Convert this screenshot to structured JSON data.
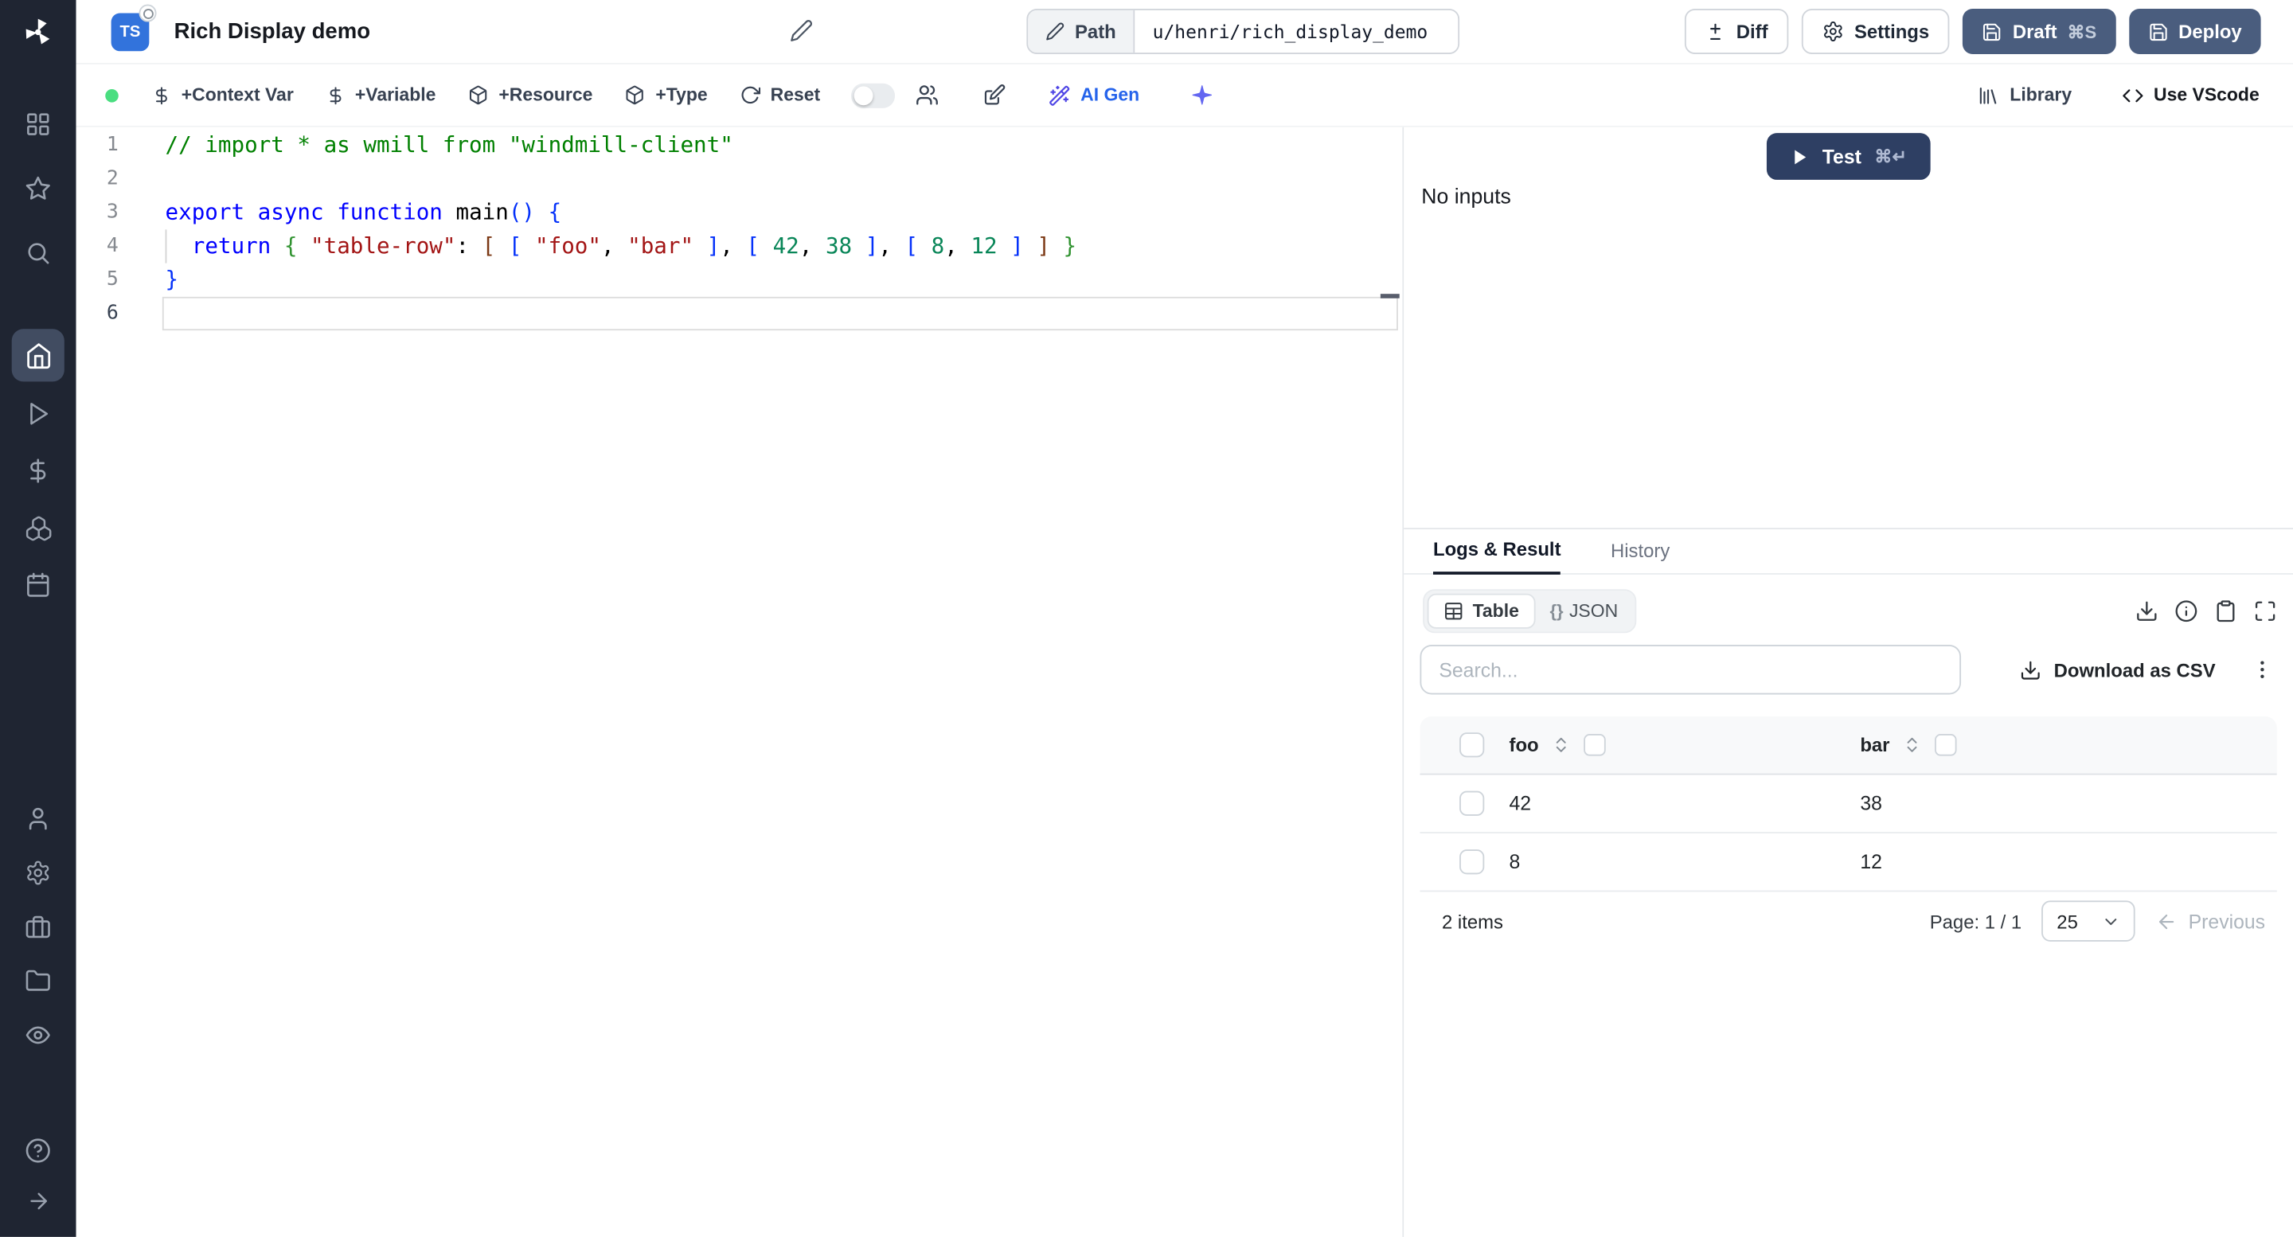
{
  "sidebar": {
    "icon_names": [
      "windmill-logo",
      "apps-grid",
      "favorites-star",
      "search",
      "home",
      "runs-play",
      "variables-dollar",
      "resources-boxes",
      "schedules-calendar",
      "users",
      "settings-gear",
      "workers-briefcase",
      "folders",
      "audit-eye",
      "help",
      "expand-arrow"
    ]
  },
  "header": {
    "lang_badge": "TS",
    "title": "Rich Display demo",
    "path_label": "Path",
    "path_value": "u/henri/rich_display_demo",
    "diff_label": "Diff",
    "settings_label": "Settings",
    "draft_label": "Draft",
    "draft_shortcut": "⌘S",
    "deploy_label": "Deploy"
  },
  "toolbar": {
    "context_var_label": "+Context Var",
    "variable_label": "+Variable",
    "resource_label": "+Resource",
    "type_label": "+Type",
    "reset_label": "Reset",
    "ai_gen_label": "AI Gen",
    "library_label": "Library",
    "vscode_label": "Use VScode"
  },
  "editor": {
    "lines": [
      {
        "n": 1,
        "tokens": [
          {
            "c": "comment",
            "t": "// import * as wmill from \"windmill-client\""
          }
        ]
      },
      {
        "n": 2,
        "tokens": []
      },
      {
        "n": 3,
        "tokens": [
          {
            "c": "kw",
            "t": "export"
          },
          {
            "c": "plain",
            "t": " "
          },
          {
            "c": "kw",
            "t": "async"
          },
          {
            "c": "plain",
            "t": " "
          },
          {
            "c": "kw",
            "t": "function"
          },
          {
            "c": "plain",
            "t": " main"
          },
          {
            "c": "b1",
            "t": "()"
          },
          {
            "c": "plain",
            "t": " "
          },
          {
            "c": "b1",
            "t": "{"
          }
        ]
      },
      {
        "n": 4,
        "tokens": [
          {
            "c": "plain",
            "t": "  "
          },
          {
            "c": "kw",
            "t": "return"
          },
          {
            "c": "plain",
            "t": " "
          },
          {
            "c": "b2",
            "t": "{"
          },
          {
            "c": "plain",
            "t": " "
          },
          {
            "c": "str",
            "t": "\"table-row\""
          },
          {
            "c": "plain",
            "t": ": "
          },
          {
            "c": "b3",
            "t": "["
          },
          {
            "c": "plain",
            "t": " "
          },
          {
            "c": "b1",
            "t": "["
          },
          {
            "c": "plain",
            "t": " "
          },
          {
            "c": "str",
            "t": "\"foo\""
          },
          {
            "c": "plain",
            "t": ", "
          },
          {
            "c": "str",
            "t": "\"bar\""
          },
          {
            "c": "plain",
            "t": " "
          },
          {
            "c": "b1",
            "t": "]"
          },
          {
            "c": "plain",
            "t": ", "
          },
          {
            "c": "b1",
            "t": "["
          },
          {
            "c": "plain",
            "t": " "
          },
          {
            "c": "num",
            "t": "42"
          },
          {
            "c": "plain",
            "t": ", "
          },
          {
            "c": "num",
            "t": "38"
          },
          {
            "c": "plain",
            "t": " "
          },
          {
            "c": "b1",
            "t": "]"
          },
          {
            "c": "plain",
            "t": ", "
          },
          {
            "c": "b1",
            "t": "["
          },
          {
            "c": "plain",
            "t": " "
          },
          {
            "c": "num",
            "t": "8"
          },
          {
            "c": "plain",
            "t": ", "
          },
          {
            "c": "num",
            "t": "12"
          },
          {
            "c": "plain",
            "t": " "
          },
          {
            "c": "b1",
            "t": "]"
          },
          {
            "c": "plain",
            "t": " "
          },
          {
            "c": "b3",
            "t": "]"
          },
          {
            "c": "plain",
            "t": " "
          },
          {
            "c": "b2",
            "t": "}"
          }
        ]
      },
      {
        "n": 5,
        "tokens": [
          {
            "c": "b1",
            "t": "}"
          }
        ]
      },
      {
        "n": 6,
        "tokens": [],
        "current": true
      }
    ]
  },
  "run_panel": {
    "test_label": "Test",
    "test_shortcut": "⌘↵",
    "no_inputs": "No inputs",
    "tabs": [
      {
        "label": "Logs & Result"
      },
      {
        "label": "History"
      }
    ],
    "view_toggle": {
      "table_label": "Table",
      "json_prefix": "{}",
      "json_label": "JSON"
    },
    "search_placeholder": "Search...",
    "download_csv_label": "Download as CSV",
    "table": {
      "columns": [
        "foo",
        "bar"
      ],
      "rows": [
        [
          "42",
          "38"
        ],
        [
          "8",
          "12"
        ]
      ],
      "items_label": "2 items",
      "page_label": "Page: 1 / 1",
      "page_size": "25",
      "previous_label": "Previous"
    }
  }
}
